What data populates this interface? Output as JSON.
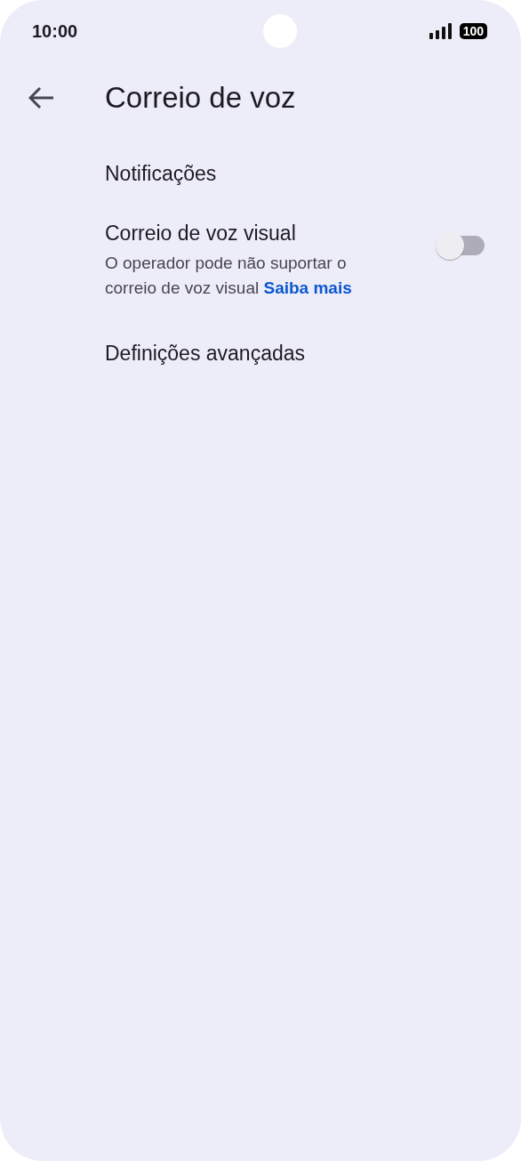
{
  "status_bar": {
    "time": "10:00",
    "battery": "100"
  },
  "app_bar": {
    "title": "Correio de voz"
  },
  "items": [
    {
      "kind": "link",
      "title": "Notificações"
    },
    {
      "kind": "switch",
      "title": "Correio de voz visual",
      "summary": "O operador pode não suportar o correio de voz visual",
      "link": "Saiba mais",
      "on": false
    },
    {
      "kind": "link",
      "title": "Definições avançadas"
    }
  ]
}
